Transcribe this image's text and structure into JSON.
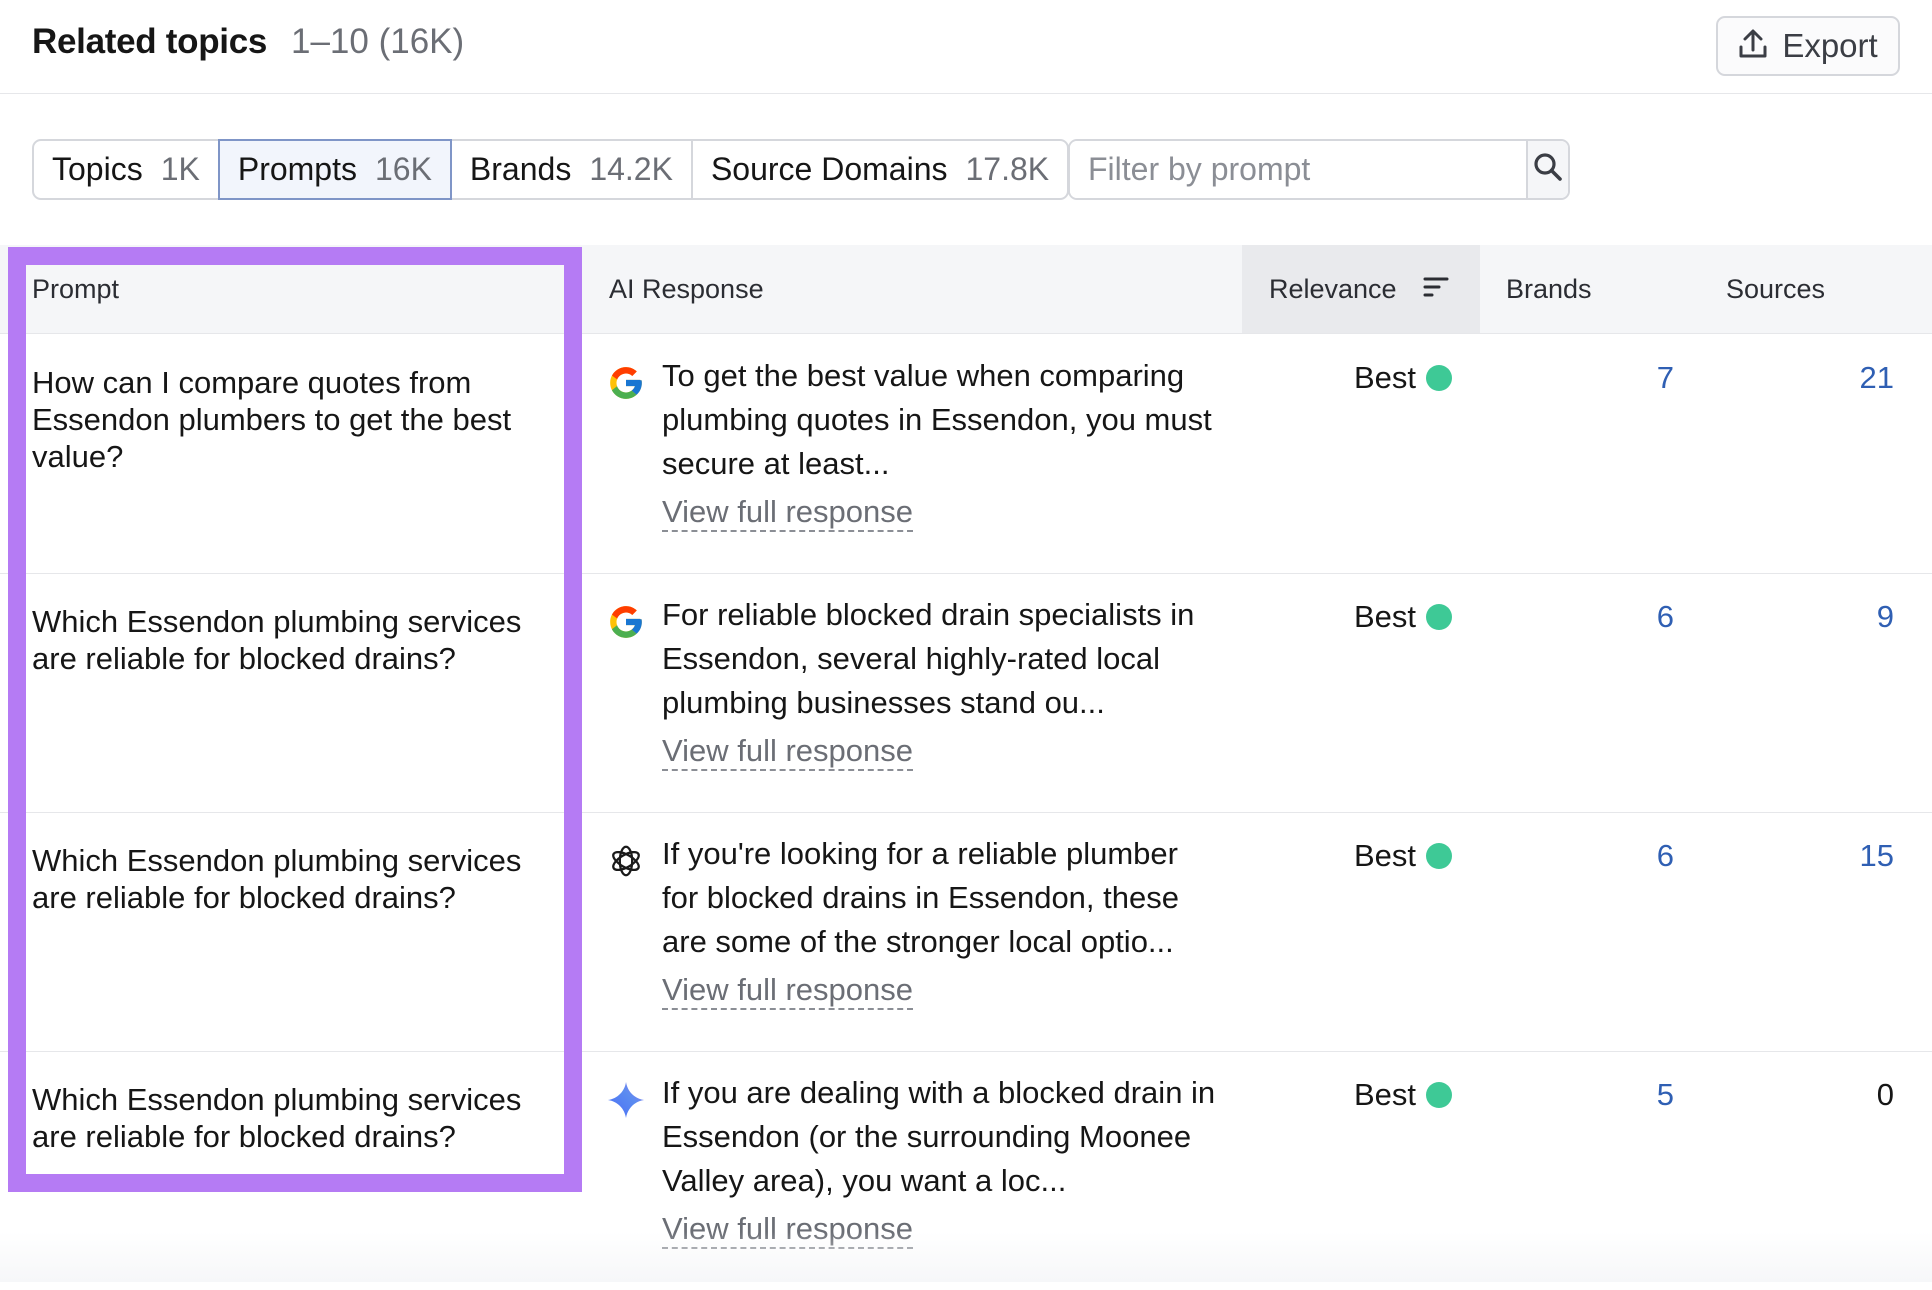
{
  "header": {
    "title": "Related topics",
    "count": "1–10 (16K)",
    "export_label": "Export"
  },
  "tabs": [
    {
      "label": "Topics",
      "count": "1K",
      "active": false
    },
    {
      "label": "Prompts",
      "count": "16K",
      "active": true
    },
    {
      "label": "Brands",
      "count": "14.2K",
      "active": false
    },
    {
      "label": "Source Domains",
      "count": "17.8K",
      "active": false
    }
  ],
  "filter": {
    "placeholder": "Filter by prompt",
    "value": ""
  },
  "columns": {
    "prompt": "Prompt",
    "ai_response": "AI Response",
    "relevance": "Relevance",
    "brands": "Brands",
    "sources": "Sources"
  },
  "rows": [
    {
      "prompt": "How can I compare quotes from Essendon plumbers to get the best value?",
      "engine_icon": "google-icon",
      "response": "To get the best value when comparing plumbing quotes in Essendon, you must secure at least...",
      "view_label": "View full response",
      "relevance": "Best",
      "brands": "7",
      "sources": "21"
    },
    {
      "prompt": "Which Essendon plumbing services are reliable for blocked drains?",
      "engine_icon": "google-icon",
      "response": "For reliable blocked drain specialists in Essendon, several highly-rated local plumbing businesses stand ou...",
      "view_label": "View full response",
      "relevance": "Best",
      "brands": "6",
      "sources": "9"
    },
    {
      "prompt": "Which Essendon plumbing services are reliable for blocked drains?",
      "engine_icon": "chatgpt-icon",
      "response": "If you're looking for a reliable plumber for blocked drains in Essendon, these are some of the stronger local optio...",
      "view_label": "View full response",
      "relevance": "Best",
      "brands": "6",
      "sources": "15"
    },
    {
      "prompt": "Which Essendon plumbing services are reliable for blocked drains?",
      "engine_icon": "gemini-icon",
      "response": "If you are dealing with a blocked drain in Essendon (or the surrounding Moonee Valley area), you want a loc...",
      "view_label": "View full response",
      "relevance": "Best",
      "brands": "5",
      "sources": "0"
    }
  ],
  "colors": {
    "highlight": "#b57bf4",
    "link": "#2f5fb3",
    "relevance_dot": "#3ec996",
    "active_tab_border": "#7f95c7"
  }
}
